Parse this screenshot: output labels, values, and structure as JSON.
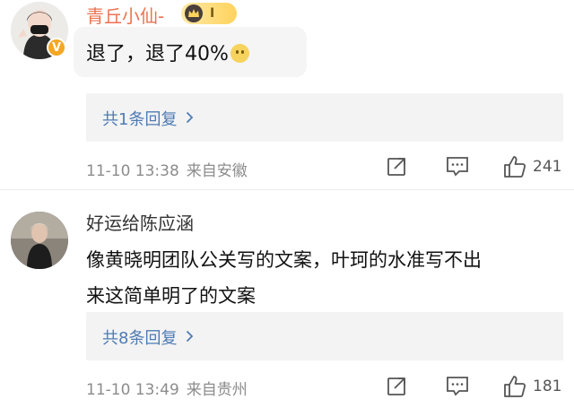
{
  "comments": [
    {
      "username": "青丘小仙-",
      "level": "I",
      "verified": "V",
      "text": "退了，退了40%",
      "reply_link": "共1条回复",
      "time": "11-10 13:38",
      "location": "来自安徽",
      "likes": "241"
    },
    {
      "username": "好运给陈应涵",
      "text_line1": "像黄晓明团队公关写的文案，叶珂的水准写不出",
      "text_line2": "来这简单明了的文案",
      "reply_link": "共8条回复",
      "time": "11-10 13:49",
      "location": "来自贵州",
      "likes": "181"
    }
  ],
  "colors": {
    "link": "#4f7bb5",
    "username_vip": "#eb7350",
    "meta": "#8c8c8c"
  }
}
